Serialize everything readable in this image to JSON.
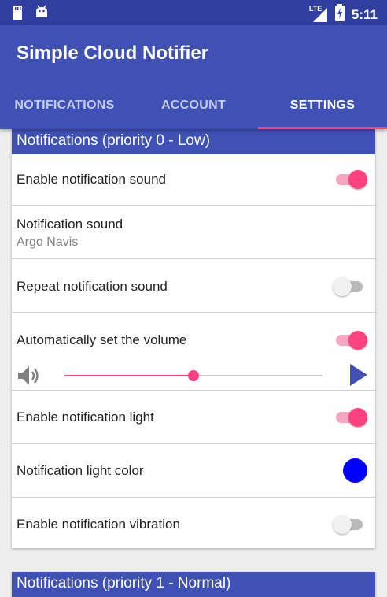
{
  "status_bar": {
    "icons": [
      "sd-card-icon",
      "android-icon",
      "lte-signal-icon",
      "battery-charging-icon"
    ],
    "network": "LTE",
    "time": "5:11"
  },
  "app": {
    "title": "Simple Cloud Notifier"
  },
  "tabs": [
    {
      "label": "NOTIFICATIONS",
      "active": false
    },
    {
      "label": "ACCOUNT",
      "active": false
    },
    {
      "label": "SETTINGS",
      "active": true
    }
  ],
  "colors": {
    "primary": "#3f51b5",
    "primary_dark": "#303f9f",
    "accent": "#ff4081",
    "light_color": "#0000ff"
  },
  "settings": {
    "section_low": {
      "header": "Notifications (priority 0 - Low)",
      "enable_sound": {
        "label": "Enable notification sound",
        "on": true
      },
      "sound": {
        "label": "Notification sound",
        "value": "Argo Navis"
      },
      "repeat_sound": {
        "label": "Repeat notification sound",
        "on": false
      },
      "auto_volume": {
        "label": "Automatically set the volume",
        "on": true,
        "volume_fraction": 0.5
      },
      "enable_light": {
        "label": "Enable notification light",
        "on": true
      },
      "light_color": {
        "label": "Notification light color",
        "color": "#0000ff"
      },
      "enable_vibration": {
        "label": "Enable notification vibration",
        "on": false
      }
    },
    "section_normal": {
      "header": "Notifications (priority 1 - Normal)"
    }
  }
}
